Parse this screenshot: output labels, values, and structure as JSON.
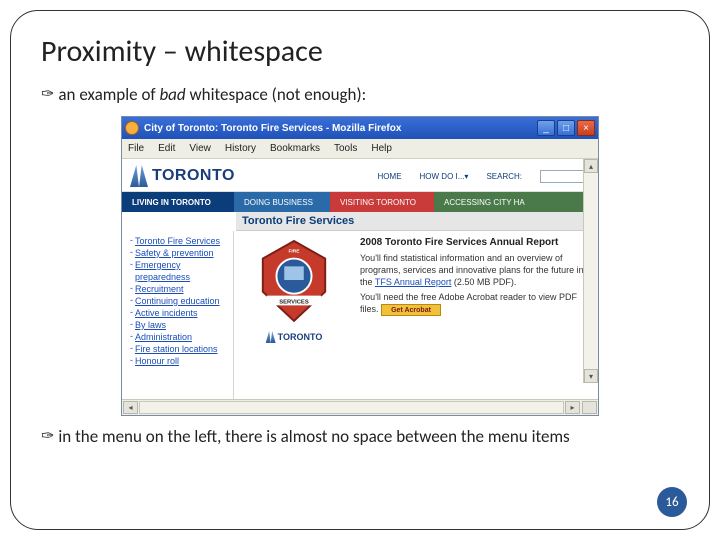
{
  "slide": {
    "title": "Proximity – whitespace",
    "bullet_glyph": "✑",
    "bullet1_prefix": "an example of ",
    "bullet1_italic": "bad",
    "bullet1_suffix": " whitespace (not enough):",
    "bullet2": "in the menu on the left, there is almost no space between the menu items",
    "page_number": "16"
  },
  "browser": {
    "window_title": "City of Toronto: Toronto Fire Services - Mozilla Firefox",
    "menus": [
      "File",
      "Edit",
      "View",
      "History",
      "Bookmarks",
      "Tools",
      "Help"
    ],
    "win_min": "_",
    "win_max": "□",
    "win_close": "×"
  },
  "page": {
    "logo_text": "TORONTO",
    "topnav": {
      "home": "HOME",
      "howdo": "HOW DO I...▾",
      "search_label": "SEARCH:"
    },
    "tabs": {
      "living": "LIVING IN TORONTO",
      "doing": "DOING BUSINESS",
      "visiting": "VISITING TORONTO",
      "accessing": "ACCESSING CITY HA"
    },
    "subheading": "Toronto Fire Services",
    "sidebar_links": [
      "Toronto Fire Services",
      "Safety & prevention",
      "Emergency preparedness",
      "Recruitment",
      "Continuing education",
      "Active incidents",
      "By laws",
      "Administration",
      "Fire station locations",
      "Honour roll"
    ],
    "center": {
      "mini_logo": "TORONTO"
    },
    "right": {
      "title": "2008 Toronto Fire Services Annual Report",
      "body1": "You'll find statistical information and an overview of programs, services and innovative plans for the future in the ",
      "link": "TFS Annual Report",
      "body1_tail": " (2.50 MB PDF).",
      "body2a": "You'll need the free Adobe Acrobat reader to view PDF files. ",
      "acrobat_label": "Get Acrobat"
    }
  }
}
